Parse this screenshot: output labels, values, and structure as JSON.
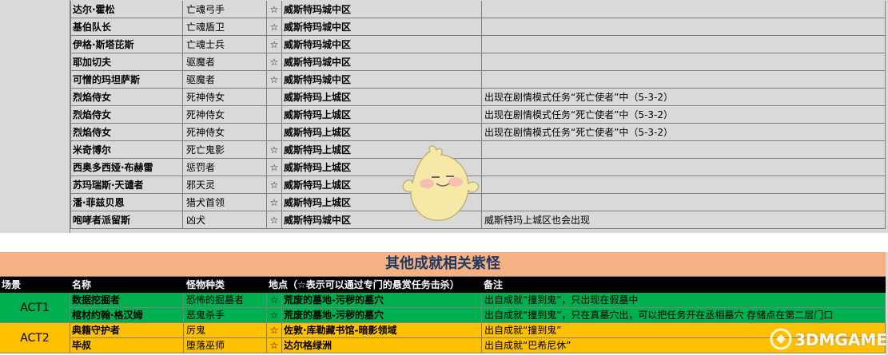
{
  "top_table": {
    "rows": [
      {
        "name": "达尔·霍松",
        "type": "亡魂弓手",
        "star": "☆",
        "location": "威斯特玛城中区",
        "note": ""
      },
      {
        "name": "基伯队长",
        "type": "亡魂盾卫",
        "star": "☆",
        "location": "威斯特玛城中区",
        "note": ""
      },
      {
        "name": "伊格·斯塔芘斯",
        "type": "亡魂士兵",
        "star": "☆",
        "location": "威斯特玛城中区",
        "note": ""
      },
      {
        "name": "耶加切夫",
        "type": "驱魔者",
        "star": "☆",
        "location": "威斯特玛城中区",
        "note": ""
      },
      {
        "name": "可憎的玛坦萨斯",
        "type": "驱魔者",
        "star": "☆",
        "location": "威斯特玛城中区",
        "note": ""
      },
      {
        "name": "烈焰侍女",
        "type": "死神侍女",
        "star": "",
        "location": "威斯特玛上城区",
        "note": "出现在剧情模式任务“死亡使者”中（5-3-2）"
      },
      {
        "name": "烈焰侍女",
        "type": "死神侍女",
        "star": "",
        "location": "威斯特玛上城区",
        "note": "出现在剧情模式任务“死亡使者”中（5-3-2）"
      },
      {
        "name": "烈焰侍女",
        "type": "死神侍女",
        "star": "",
        "location": "威斯特玛上城区",
        "note": "出现在剧情模式任务“死亡使者”中（5-3-2）"
      },
      {
        "name": "米奇博尔",
        "type": "死亡鬼影",
        "star": "☆",
        "location": "威斯特玛上城区",
        "note": ""
      },
      {
        "name": "西奥多西娅·布赫雷",
        "type": "惩罚者",
        "star": "☆",
        "location": "威斯特玛上城区",
        "note": ""
      },
      {
        "name": "苏玛瑞斯·天谴者",
        "type": "邪天灵",
        "star": "☆",
        "location": "威斯特玛上城区",
        "note": ""
      },
      {
        "name": "潘·菲兹贝恩",
        "type": "猎犬首领",
        "star": "☆",
        "location": "威斯特玛上城区",
        "note": ""
      },
      {
        "name": "咆哮者派留斯",
        "type": "凶犬",
        "star": "☆",
        "location": "威斯特玛城中区",
        "note": "威斯特玛上城区也会出现"
      }
    ]
  },
  "other_section": {
    "title": "其他成就相关紫怪",
    "headers": {
      "scene": "场景",
      "name": "名称",
      "type": "怪物种类",
      "location": "地点（☆表示可以通过专门的悬赏任务击杀）",
      "note": "备注"
    },
    "acts": [
      {
        "label": "ACT1",
        "color": "#00b050",
        "rows": [
          {
            "name": "数据挖掘者",
            "type": "恐怖的掘墓者",
            "star": "☆",
            "location": "荒废的墓地-污秽的墓穴",
            "note": "出自成就“撞到鬼”，只出现在假墓中"
          },
          {
            "name": "棺材约翰·格汉姆",
            "type": "恶鬼杀手",
            "star": "☆",
            "location": "荒废的墓地-污秽的墓穴",
            "note": "出自成就“撞到鬼”，只在真墓穴出，可以把任务开在丞相墓穴 存储点在第二层门口"
          }
        ]
      },
      {
        "label": "ACT2",
        "color": "#ffc000",
        "rows": [
          {
            "name": "典籍守护者",
            "type": "厉鬼",
            "star": "☆",
            "location": "佐敦·库勒藏书馆-暗影领域",
            "note": "出自成就“撞到鬼”"
          },
          {
            "name": "毕叔",
            "type": "堕落巫师",
            "star": "☆",
            "location": "达尔格绿洲",
            "note": "出自成就“巴希尼休”"
          }
        ]
      }
    ]
  },
  "watermark": {
    "text": "3DMGAME"
  },
  "colors": {
    "top_bg": "#d9d9d9",
    "title_bg": "#f4b183",
    "title_text": "#1f3864",
    "header_bg": "#000000",
    "act1": "#00b050",
    "act2": "#ffc000"
  }
}
